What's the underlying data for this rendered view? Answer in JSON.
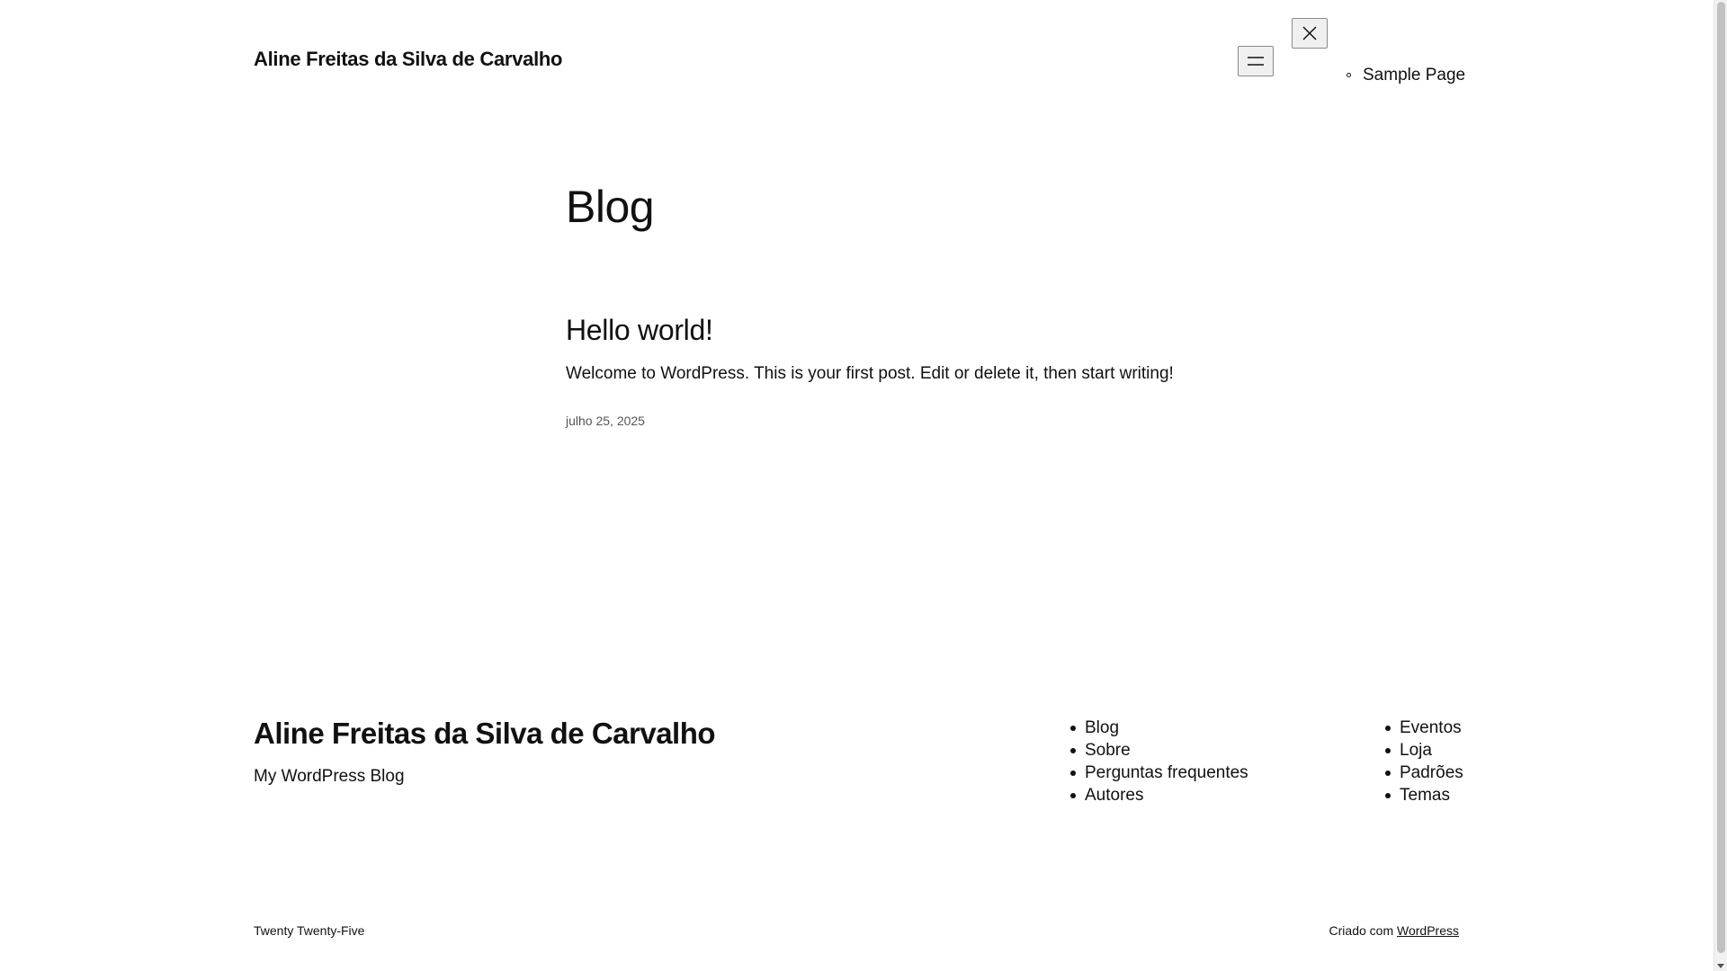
{
  "header": {
    "site_title": "Aline Freitas da Silva de Carvalho",
    "menu_open_icon": "hamburger-menu-icon",
    "menu_close_icon": "close-icon",
    "nav_items": [
      {
        "label": "Sample Page"
      }
    ]
  },
  "main": {
    "page_title": "Blog",
    "posts": [
      {
        "title": "Hello world!",
        "excerpt": "Welcome to WordPress. This is your first post. Edit or delete it, then start writing!",
        "date": "julho 25, 2025"
      }
    ]
  },
  "footer": {
    "site_title": "Aline Freitas da Silva de Carvalho",
    "tagline": "My WordPress Blog",
    "nav_column_1": [
      {
        "label": "Blog"
      },
      {
        "label": "Sobre"
      },
      {
        "label": "Perguntas frequentes"
      },
      {
        "label": "Autores"
      }
    ],
    "nav_column_2": [
      {
        "label": "Eventos"
      },
      {
        "label": "Loja"
      },
      {
        "label": "Padrões"
      },
      {
        "label": "Temas"
      }
    ],
    "theme_credit": "Twenty Twenty-Five",
    "powered_by_prefix": "Criado com",
    "powered_by_link": "WordPress"
  },
  "colors": {
    "text": "#111111",
    "background": "#ffffff",
    "muted": "#555555"
  }
}
